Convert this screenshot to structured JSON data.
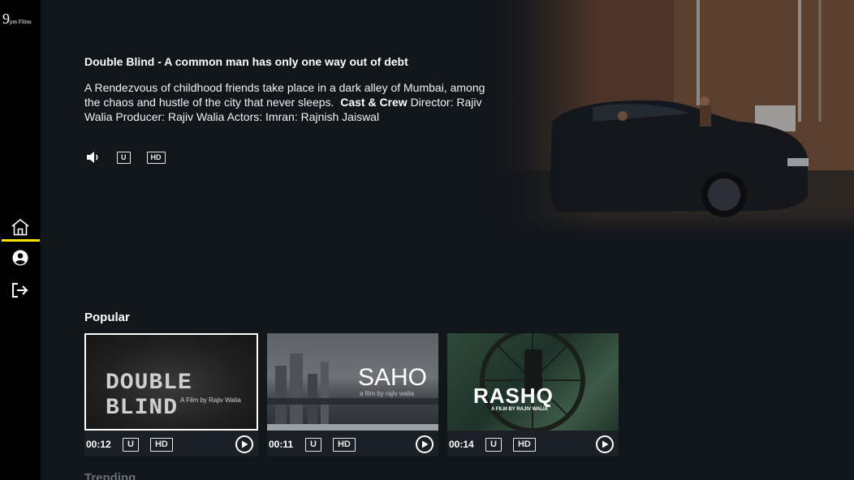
{
  "brand": {
    "logo_number": "9",
    "logo_text": "pm Films"
  },
  "sidebar": {
    "items": [
      {
        "name": "home",
        "icon": "home-icon",
        "active": true
      },
      {
        "name": "profile",
        "icon": "user-circle-icon",
        "active": false
      },
      {
        "name": "logout",
        "icon": "logout-icon",
        "active": false
      }
    ],
    "active_color": "#f2e400"
  },
  "hero": {
    "title": "Double Blind - A common man has only one way out of debt",
    "description": "A Rendezvous of childhood friends take place in a dark alley of Mumbai, among the chaos and hustle of the city that never sleeps.",
    "cast_label": "Cast & Crew",
    "cast_text": "Director: Rajiv Walia Producer: Rajiv Walia Actors: Imran: Rajnish Jaiswal",
    "badges": {
      "rating": "U",
      "quality": "HD"
    },
    "volume_icon": "volume-icon"
  },
  "popular": {
    "title": "Popular",
    "items": [
      {
        "thumb_title": "DOUBLE BLIND",
        "thumb_subtitle": "A Film by Rajiv Walia",
        "duration": "00:12",
        "rating": "U",
        "quality": "HD",
        "selected": true
      },
      {
        "thumb_title": "SAHO",
        "thumb_subtitle": "a film by rajiv walia",
        "duration": "00:11",
        "rating": "U",
        "quality": "HD",
        "selected": false
      },
      {
        "thumb_title": "RASHQ",
        "thumb_subtitle": "A FILM BY RAJIV WALIA",
        "duration": "00:14",
        "rating": "U",
        "quality": "HD",
        "selected": false
      }
    ]
  },
  "trending": {
    "title": "Trending"
  }
}
